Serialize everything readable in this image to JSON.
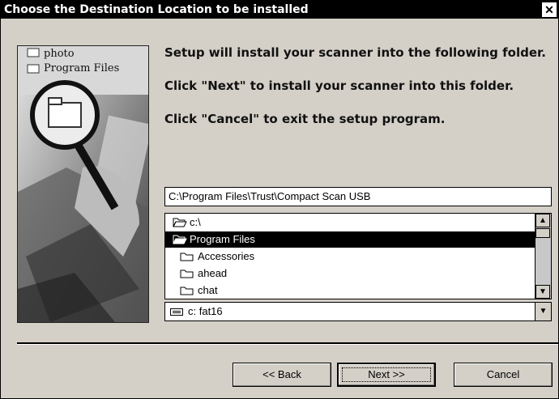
{
  "window": {
    "title": "Choose the Destination Location to be installed",
    "close_glyph": "✕"
  },
  "side_image": {
    "labels": [
      "photo",
      "Program Files"
    ]
  },
  "messages": [
    "Setup will install your scanner into the following folder.",
    "Click \"Next\" to install your scanner into this folder.",
    "Click \"Cancel\" to exit the setup program."
  ],
  "path_field": {
    "value": "C:\\Program Files\\Trust\\Compact Scan USB"
  },
  "folder_list": {
    "items": [
      {
        "label": "c:\\",
        "icon": "open-folder-icon",
        "selected": false
      },
      {
        "label": "Program Files",
        "icon": "open-folder-icon",
        "selected": true
      },
      {
        "label": "Accessories",
        "icon": "folder-icon",
        "selected": false
      },
      {
        "label": "ahead",
        "icon": "folder-icon",
        "selected": false
      },
      {
        "label": "chat",
        "icon": "folder-icon",
        "selected": false
      }
    ]
  },
  "drive_select": {
    "value": "c: fat16",
    "icon": "hard-drive-icon"
  },
  "buttons": {
    "back": "<< Back",
    "next": "Next >>",
    "cancel": "Cancel"
  }
}
